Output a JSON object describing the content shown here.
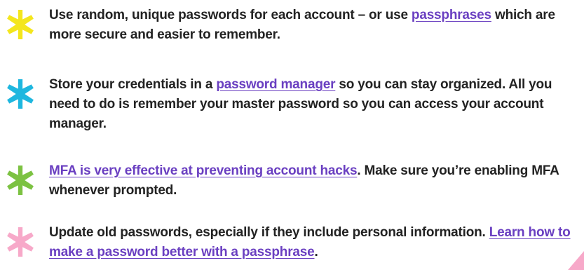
{
  "tips": [
    {
      "star_color": "#f4e61d",
      "icon": "asterisk-star-icon",
      "segments": [
        {
          "text": "Use random, unique passwords for each account – or use ",
          "link": false
        },
        {
          "text": "passphrases",
          "link": true
        },
        {
          "text": " which are more secure and easier to remember.",
          "link": false
        }
      ]
    },
    {
      "star_color": "#1fb7df",
      "icon": "asterisk-star-icon",
      "segments": [
        {
          "text": "Store your credentials in a ",
          "link": false
        },
        {
          "text": "password manager",
          "link": true
        },
        {
          "text": " so you can stay organized. All you need to do is remember your master password so you can access your account manager.",
          "link": false
        }
      ]
    },
    {
      "star_color": "#7cc242",
      "icon": "asterisk-star-icon",
      "segments": [
        {
          "text": "MFA is very effective at preventing account hacks",
          "link": true
        },
        {
          "text": ". Make sure you’re enabling MFA whenever prompted.",
          "link": false
        }
      ]
    },
    {
      "star_color": "#f7a9c9",
      "icon": "asterisk-star-icon",
      "segments": [
        {
          "text": "Update old passwords, especially if they include personal information. ",
          "link": false
        },
        {
          "text": "Learn how to make a password better with a passphrase",
          "link": true
        },
        {
          "text": ".",
          "link": false
        }
      ]
    }
  ],
  "decoration": {
    "color": "#f7a9c9",
    "icon": "pink-triangle-shape"
  },
  "link_color": "#6a3fc1"
}
